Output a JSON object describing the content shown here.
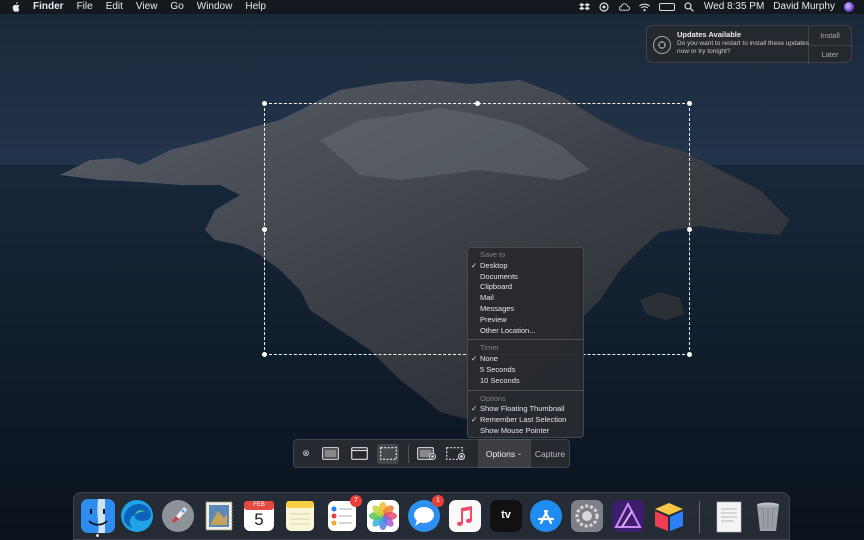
{
  "menubar": {
    "apple_icon": "apple-icon",
    "app_name": "Finder",
    "items": [
      "File",
      "Edit",
      "View",
      "Go",
      "Window",
      "Help"
    ],
    "status_icons": [
      "dropbox-icon",
      "vpn-icon",
      "cloud-icon",
      "wifi-icon",
      "battery-icon",
      "search-icon",
      "siri-icon"
    ],
    "clock": "Wed 8:35 PM",
    "user": "David Murphy"
  },
  "notification": {
    "title": "Updates Available",
    "text": "Do you want to restart to install these updates now or try tonight?",
    "install_label": "Install",
    "later_label": "Later"
  },
  "options_menu": {
    "save_to_header": "Save to",
    "save_to_items": [
      {
        "label": "Desktop",
        "checked": true
      },
      {
        "label": "Documents",
        "checked": false
      },
      {
        "label": "Clipboard",
        "checked": false
      },
      {
        "label": "Mail",
        "checked": false
      },
      {
        "label": "Messages",
        "checked": false
      },
      {
        "label": "Preview",
        "checked": false
      },
      {
        "label": "Other Location...",
        "checked": false
      }
    ],
    "timer_header": "Timer",
    "timer_items": [
      {
        "label": "None",
        "checked": true
      },
      {
        "label": "5 Seconds",
        "checked": false
      },
      {
        "label": "10 Seconds",
        "checked": false
      }
    ],
    "options_header": "Options",
    "options_items": [
      {
        "label": "Show Floating Thumbnail",
        "checked": true
      },
      {
        "label": "Remember Last Selection",
        "checked": true
      },
      {
        "label": "Show Mouse Pointer",
        "checked": false
      }
    ],
    "check_glyph": "✓"
  },
  "toolbar": {
    "close_glyph": "⊗",
    "options_label": "Options",
    "options_caret": "⌄",
    "capture_label": "Capture"
  },
  "dock": {
    "calendar_month": "FEB",
    "calendar_day": "5",
    "reminders_badge": "7",
    "messages_badge": "1",
    "tv_label": "tv"
  },
  "colors": {
    "accent": "#1f7df2",
    "badge": "#e8413a"
  }
}
